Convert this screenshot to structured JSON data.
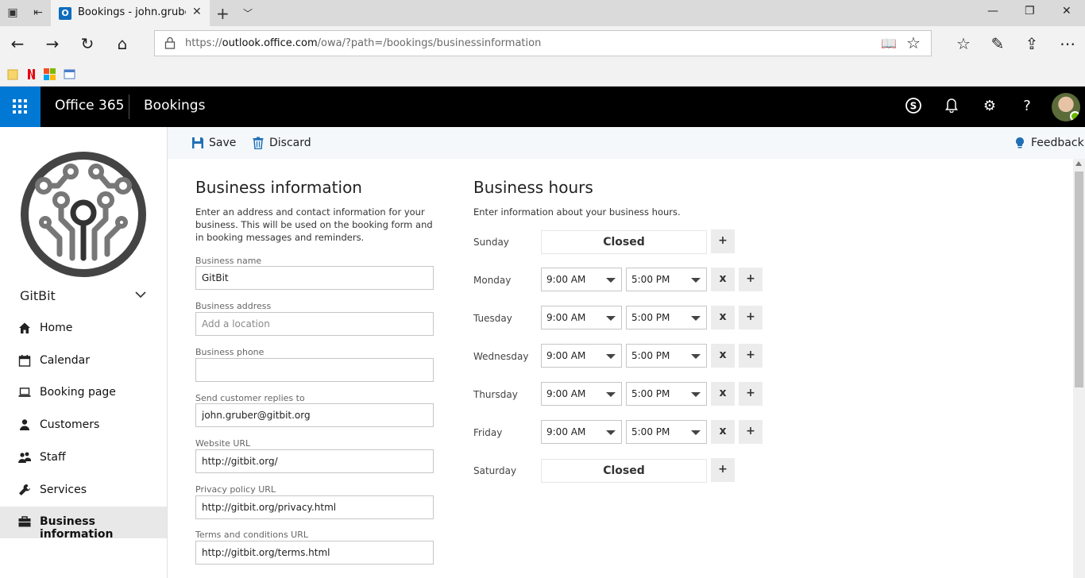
{
  "browser": {
    "tab_title": "Bookings - john.gruber@",
    "favicon_letter": "O",
    "url_prefix": "https://",
    "url_domain": "outlook.office.com",
    "url_path": "/owa/?path=/bookings/businessinformation"
  },
  "o365": {
    "brand": "Office 365",
    "app": "Bookings"
  },
  "sidebar": {
    "business_name": "GitBit",
    "items": [
      {
        "label": "Home",
        "icon": "home-icon"
      },
      {
        "label": "Calendar",
        "icon": "calendar-icon"
      },
      {
        "label": "Booking page",
        "icon": "laptop-icon"
      },
      {
        "label": "Customers",
        "icon": "person-icon"
      },
      {
        "label": "Staff",
        "icon": "people-icon"
      },
      {
        "label": "Services",
        "icon": "wrench-icon"
      },
      {
        "label": "Business information",
        "icon": "briefcase-icon",
        "active": true
      }
    ]
  },
  "commandbar": {
    "save": "Save",
    "discard": "Discard",
    "feedback": "Feedback"
  },
  "business_info": {
    "title": "Business information",
    "description": "Enter an address and contact information for your business. This will be used on the booking form and in booking messages and reminders.",
    "fields": [
      {
        "label": "Business name",
        "value": "GitBit",
        "placeholder": ""
      },
      {
        "label": "Business address",
        "value": "",
        "placeholder": "Add a location"
      },
      {
        "label": "Business phone",
        "value": "",
        "placeholder": ""
      },
      {
        "label": "Send customer replies to",
        "value": "john.gruber@gitbit.org",
        "placeholder": ""
      },
      {
        "label": "Website URL",
        "value": "http://gitbit.org/",
        "placeholder": ""
      },
      {
        "label": "Privacy policy URL",
        "value": "http://gitbit.org/privacy.html",
        "placeholder": ""
      },
      {
        "label": "Terms and conditions URL",
        "value": "http://gitbit.org/terms.html",
        "placeholder": ""
      }
    ]
  },
  "business_hours": {
    "title": "Business hours",
    "description": "Enter information about your business hours.",
    "remove_label": "x",
    "add_label": "+",
    "days": [
      {
        "day": "Sunday",
        "closed": true,
        "closed_label": "Closed"
      },
      {
        "day": "Monday",
        "closed": false,
        "start": "9:00 AM",
        "end": "5:00 PM"
      },
      {
        "day": "Tuesday",
        "closed": false,
        "start": "9:00 AM",
        "end": "5:00 PM"
      },
      {
        "day": "Wednesday",
        "closed": false,
        "start": "9:00 AM",
        "end": "5:00 PM"
      },
      {
        "day": "Thursday",
        "closed": false,
        "start": "9:00 AM",
        "end": "5:00 PM"
      },
      {
        "day": "Friday",
        "closed": false,
        "start": "9:00 AM",
        "end": "5:00 PM"
      },
      {
        "day": "Saturday",
        "closed": true,
        "closed_label": "Closed"
      }
    ]
  },
  "colors": {
    "accent": "#0078d4",
    "header_bg": "#000000",
    "commandbar_bg": "#f4f8fb",
    "active_nav_bg": "#e8e8e8"
  }
}
